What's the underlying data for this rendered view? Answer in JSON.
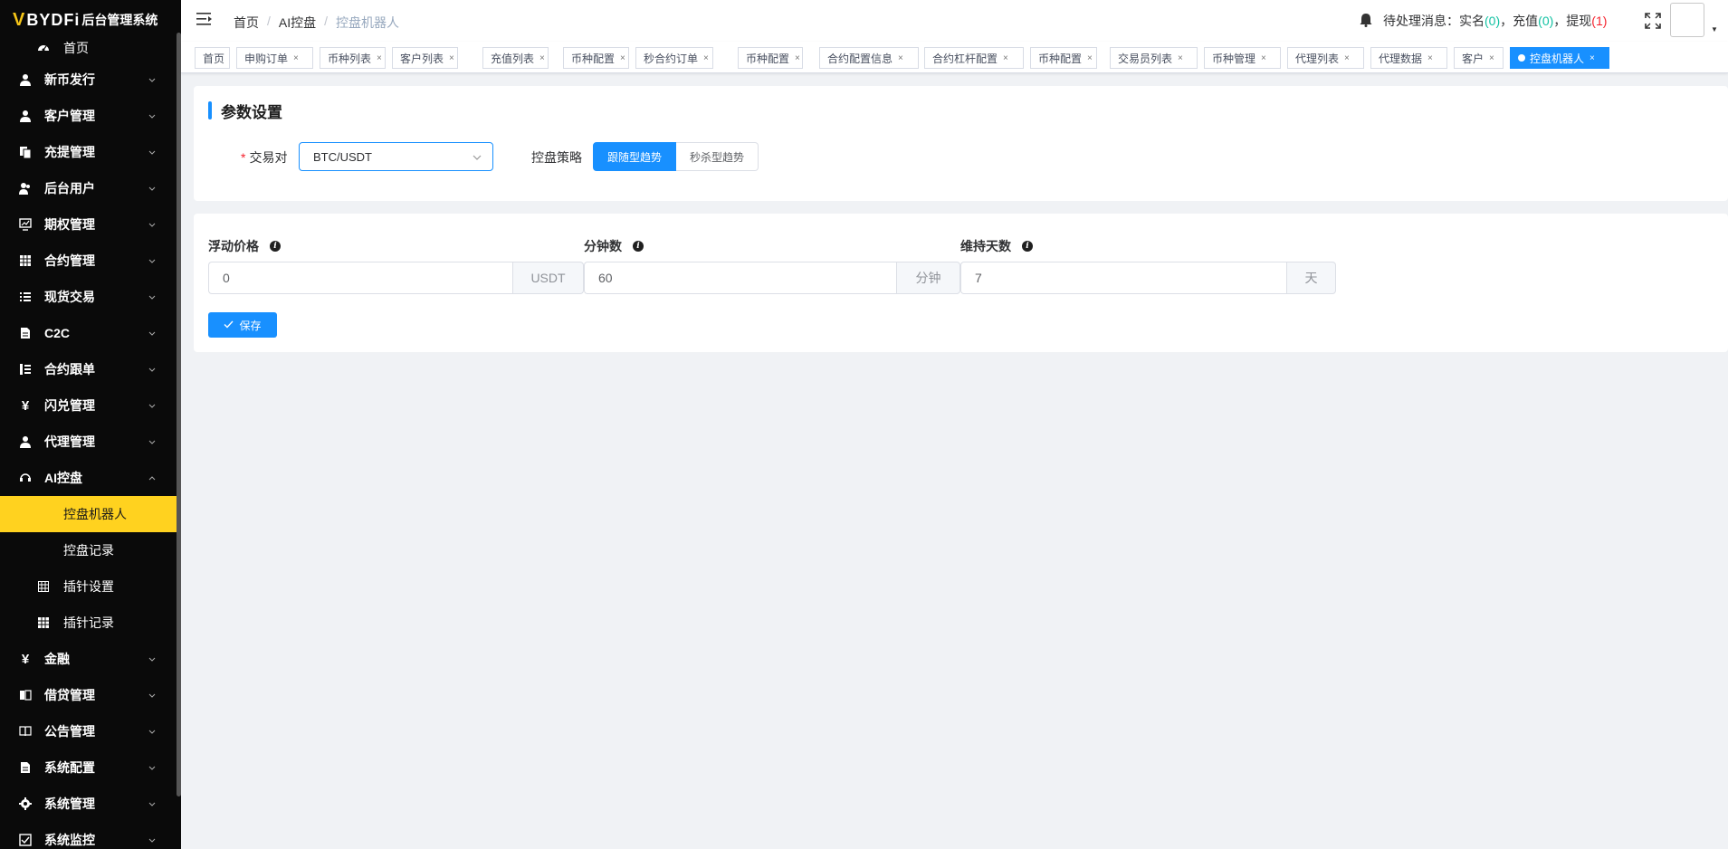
{
  "app": {
    "logo_text": "BYDFi",
    "system_name": "后台管理系统"
  },
  "sidebar": {
    "items": [
      {
        "label": "首页",
        "icon": "dashboard-icon"
      },
      {
        "label": "新币发行",
        "icon": "user-icon"
      },
      {
        "label": "客户管理",
        "icon": "user-icon"
      },
      {
        "label": "充提管理",
        "icon": "documents-icon"
      },
      {
        "label": "后台用户",
        "icon": "users-icon"
      },
      {
        "label": "期权管理",
        "icon": "chart-monitor-icon"
      },
      {
        "label": "合约管理",
        "icon": "table-icon"
      },
      {
        "label": "现货交易",
        "icon": "list-icon"
      },
      {
        "label": "C2C",
        "icon": "document-icon"
      },
      {
        "label": "合约跟单",
        "icon": "list-tree-icon"
      },
      {
        "label": "闪兑管理",
        "icon": "yen-icon"
      },
      {
        "label": "代理管理",
        "icon": "user-icon"
      },
      {
        "label": "AI控盘",
        "icon": "robot-icon"
      },
      {
        "label": "控盘机器人",
        "icon": ""
      },
      {
        "label": "控盘记录",
        "icon": ""
      },
      {
        "label": "插针设置",
        "icon": "grid-icon"
      },
      {
        "label": "插针记录",
        "icon": "table-icon"
      },
      {
        "label": "金融",
        "icon": "yen-icon"
      },
      {
        "label": "借贷管理",
        "icon": "book-icon"
      },
      {
        "label": "公告管理",
        "icon": "book-open-icon"
      },
      {
        "label": "系统配置",
        "icon": "document-icon"
      },
      {
        "label": "系统管理",
        "icon": "gear-icon"
      },
      {
        "label": "系统监控",
        "icon": "checkbox-icon"
      }
    ]
  },
  "header": {
    "breadcrumb": [
      "首页",
      "AI控盘",
      "控盘机器人"
    ],
    "notify_prefix": "待处理消息：",
    "realname_label": "实名",
    "realname_count": "0",
    "deposit_label": "充值",
    "deposit_count": "0",
    "withdraw_label": "提现",
    "withdraw_count": "1"
  },
  "tags": [
    "首页",
    "申购订单",
    "币种列表",
    "客户列表",
    "充值列表",
    "币种配置",
    "秒合约订单",
    "币种配置",
    "合约配置信息",
    "合约杠杆配置",
    "币种配置",
    "交易员列表",
    "币种管理",
    "代理列表",
    "代理数据",
    "客户",
    "控盘机器人"
  ],
  "form": {
    "title": "参数设置",
    "pair_label": "交易对",
    "pair_value": "BTC/USDT",
    "strategy_label": "控盘策略",
    "strategy_on": "跟随型趋势",
    "strategy_off": "秒杀型趋势",
    "float_price_label": "浮动价格",
    "float_price_value": "0",
    "float_price_unit": "USDT",
    "minutes_label": "分钟数",
    "minutes_value": "60",
    "minutes_unit": "分钟",
    "days_label": "维持天数",
    "days_value": "7",
    "days_unit": "天",
    "save_label": "保存"
  },
  "colors": {
    "accent": "#1890ff",
    "active_menu": "#ffd21f",
    "sidebar_bg": "#0a0a0a"
  }
}
